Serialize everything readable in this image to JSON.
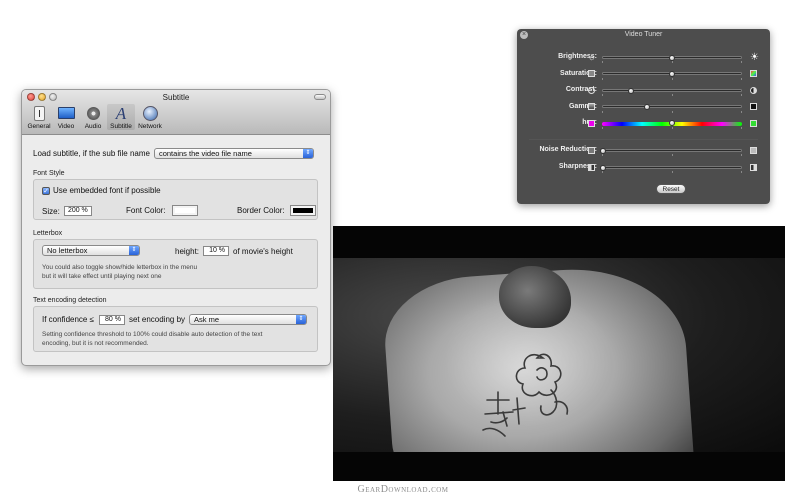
{
  "subtitle_window": {
    "title": "Subtitle",
    "toolbar": [
      {
        "label": "General",
        "icon": "general-icon"
      },
      {
        "label": "Video",
        "icon": "display-icon"
      },
      {
        "label": "Audio",
        "icon": "speaker-icon"
      },
      {
        "label": "Subtitle",
        "icon": "subtitle-letter-icon"
      },
      {
        "label": "Network",
        "icon": "globe-icon"
      }
    ],
    "load_label": "Load subtitle, if the sub file name",
    "load_option": "contains the video file name",
    "font_style": {
      "section_title": "Font Style",
      "embedded_checkbox": "Use embedded font if possible",
      "size_label": "Size:",
      "size_value": "200 %",
      "font_color_label": "Font Color:",
      "font_color": "#ffffff",
      "border_color_label": "Border Color:",
      "border_color": "#000000"
    },
    "letterbox": {
      "section_title": "Letterbox",
      "option": "No letterbox",
      "height_label": "height:",
      "height_value": "10 %",
      "height_suffix": "of movie's height",
      "note_line1": "You could also toggle show/hide letterbox in the menu",
      "note_line2": "but it will take effect until playing next one"
    },
    "encoding": {
      "section_title": "Text encoding detection",
      "confidence_label": "If confidence ≤",
      "confidence_value": "80 %",
      "set_label": "set encoding by",
      "set_option": "Ask me",
      "note_line1": "Setting confidence threshold to 100% could disable auto detection of the text",
      "note_line2": "encoding, but it is not recommended."
    }
  },
  "video_tuner": {
    "title": "Video Tuner",
    "sliders": [
      {
        "label": "Brightness:",
        "value": 0.5,
        "icon_left": "sun-small-icon",
        "icon_right": "sun-large-icon"
      },
      {
        "label": "Saturation:",
        "value": 0.5,
        "icon_left": "gray-square-icon",
        "icon_right": "color-square-icon"
      },
      {
        "label": "Contrast:",
        "value": 0.2,
        "icon_left": "circle-icon",
        "icon_right": "half-circle-icon"
      },
      {
        "label": "Gamma:",
        "value": 0.32,
        "icon_left": "gamma-low-icon",
        "icon_right": "gamma-high-icon"
      },
      {
        "label": "hue:",
        "value": 0.5,
        "icon_left": "magenta-square-icon",
        "icon_right": "green-square-icon"
      }
    ],
    "filters": [
      {
        "label": "Noise Reduction:",
        "value": 0.0,
        "icon_left": "noise-low-icon",
        "icon_right": "noise-high-icon"
      },
      {
        "label": "Sharpness:",
        "value": 0.0,
        "icon_left": "sharp-low-icon",
        "icon_right": "sharp-high-icon"
      }
    ],
    "reset_label": "Reset"
  },
  "watermark": "GearDownload.com"
}
